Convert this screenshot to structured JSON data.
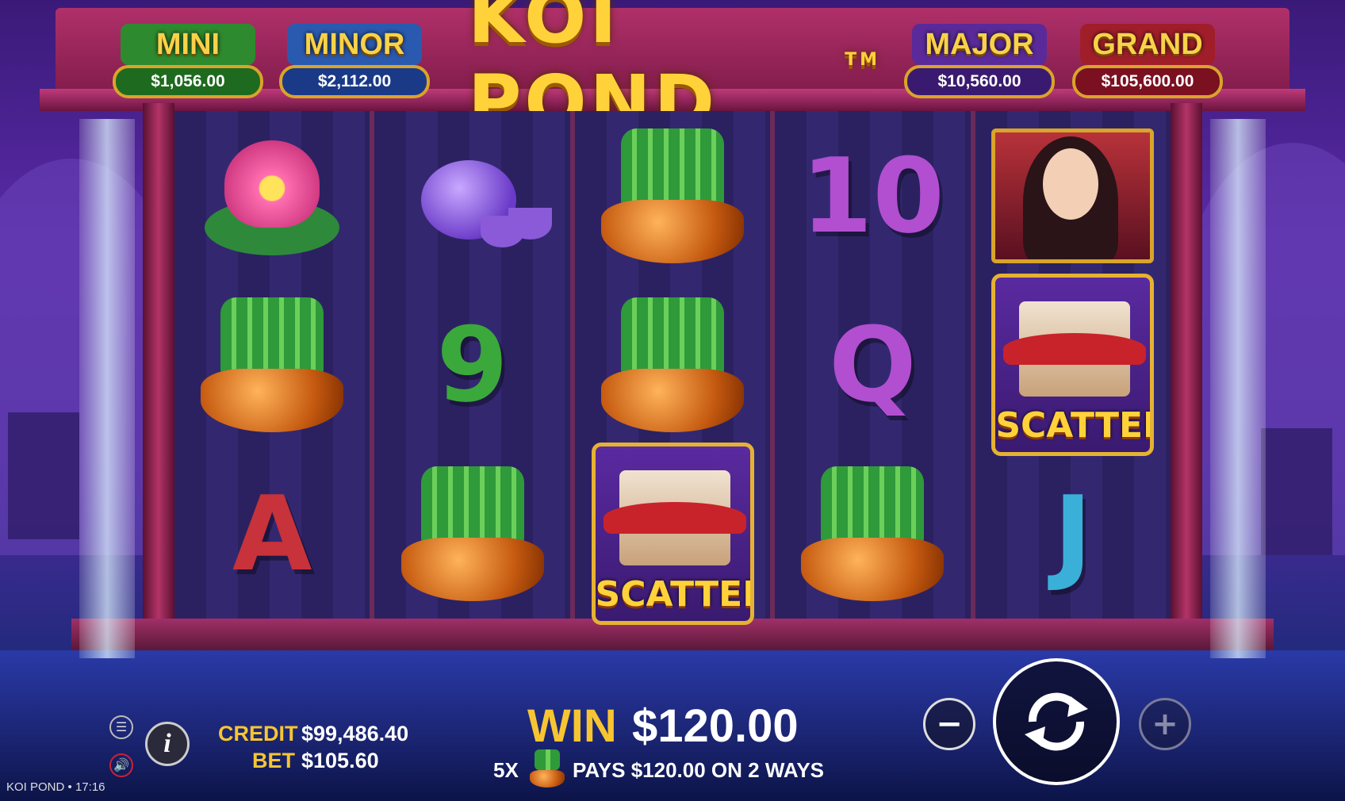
{
  "game": {
    "title": "KOI POND",
    "trademark": "TM",
    "footer_title": "KOI POND",
    "footer_separator": "•",
    "clock": "17:16"
  },
  "jackpots": [
    {
      "name": "MINI",
      "value": "$1,056.00",
      "color": "#2e8a2e"
    },
    {
      "name": "MINOR",
      "value": "$2,112.00",
      "color": "#2a5ab0"
    },
    {
      "name": "MAJOR",
      "value": "$10,560.00",
      "color": "#5a2a9a"
    },
    {
      "name": "GRAND",
      "value": "$105,600.00",
      "color": "#a01e2a"
    }
  ],
  "reels": [
    [
      "lotus",
      "bamboo-pot",
      "A"
    ],
    [
      "teapot",
      "9",
      "bamboo-pot"
    ],
    [
      "bamboo-pot",
      "bamboo-pot",
      "scatter"
    ],
    [
      "10",
      "Q",
      "bamboo-pot"
    ],
    [
      "geisha",
      "scatter",
      "J"
    ]
  ],
  "symbols": {
    "scatter_label": "SCATTER",
    "letter_A": "A",
    "letter_9": "9",
    "letter_10": "10",
    "letter_Q": "Q",
    "letter_J": "J"
  },
  "panel": {
    "credit_label": "CREDIT",
    "credit_value": "$99,486.40",
    "bet_label": "BET",
    "bet_value": "$105.60",
    "win_label": "WIN",
    "win_value": "$120.00",
    "win_detail_count": "5X",
    "win_detail_text": "PAYS $120.00 ON 2 WAYS",
    "info_label": "i",
    "minus_label": "−",
    "plus_label": "+"
  },
  "colors": {
    "gold": "#f7c531",
    "white": "#ffffff",
    "purple_letter": "#b14fd0",
    "green_letter": "#3aa83a",
    "red_letter": "#c8323a",
    "teal_letter": "#3ab0d8"
  }
}
